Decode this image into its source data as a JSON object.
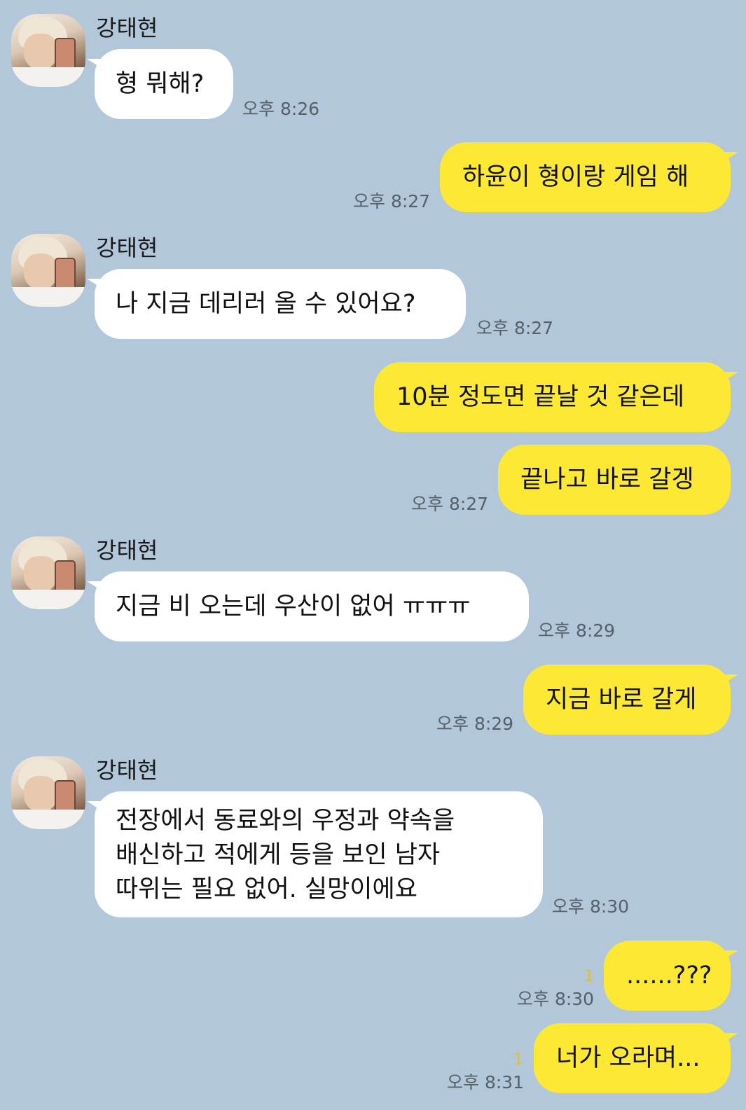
{
  "sender_name": "강태현",
  "messages": [
    {
      "dir": "in",
      "lines": [
        "형 뭐해?"
      ],
      "time": "오후 8:26"
    },
    {
      "dir": "out",
      "lines": [
        "하윤이 형이랑 게임 해"
      ],
      "time": "오후 8:27"
    },
    {
      "dir": "in",
      "lines": [
        "나 지금 데리러 올 수 있어요?"
      ],
      "time": "오후 8:27"
    },
    {
      "dir": "out",
      "lines": [
        "10분 정도면 끝날 것 같은데"
      ],
      "time": ""
    },
    {
      "dir": "out",
      "lines": [
        "끝나고 바로 갈겡"
      ],
      "time": "오후 8:27"
    },
    {
      "dir": "in",
      "lines": [
        "지금 비 오는데 우산이 없어 ㅠㅠㅠ"
      ],
      "time": "오후 8:29"
    },
    {
      "dir": "out",
      "lines": [
        "지금 바로 갈게"
      ],
      "time": "오후 8:29"
    },
    {
      "dir": "in",
      "lines": [
        "전장에서 동료와의 우정과 약속을",
        "배신하고 적에게 등을 보인 남자",
        "따위는 필요 없어. 실망이에요"
      ],
      "time": "오후 8:30"
    },
    {
      "dir": "out",
      "lines": [
        "......???"
      ],
      "time": "오후 8:30",
      "unread": "1"
    },
    {
      "dir": "out",
      "lines": [
        "너가 오라며..."
      ],
      "time": "오후 8:31",
      "unread": "1"
    }
  ],
  "colors": {
    "background": "#b2c7da",
    "incoming_bubble": "#ffffff",
    "outgoing_bubble": "#fde933",
    "unread": "#e3c21a"
  },
  "icons": {
    "avatar": "profile-photo-avatar"
  }
}
